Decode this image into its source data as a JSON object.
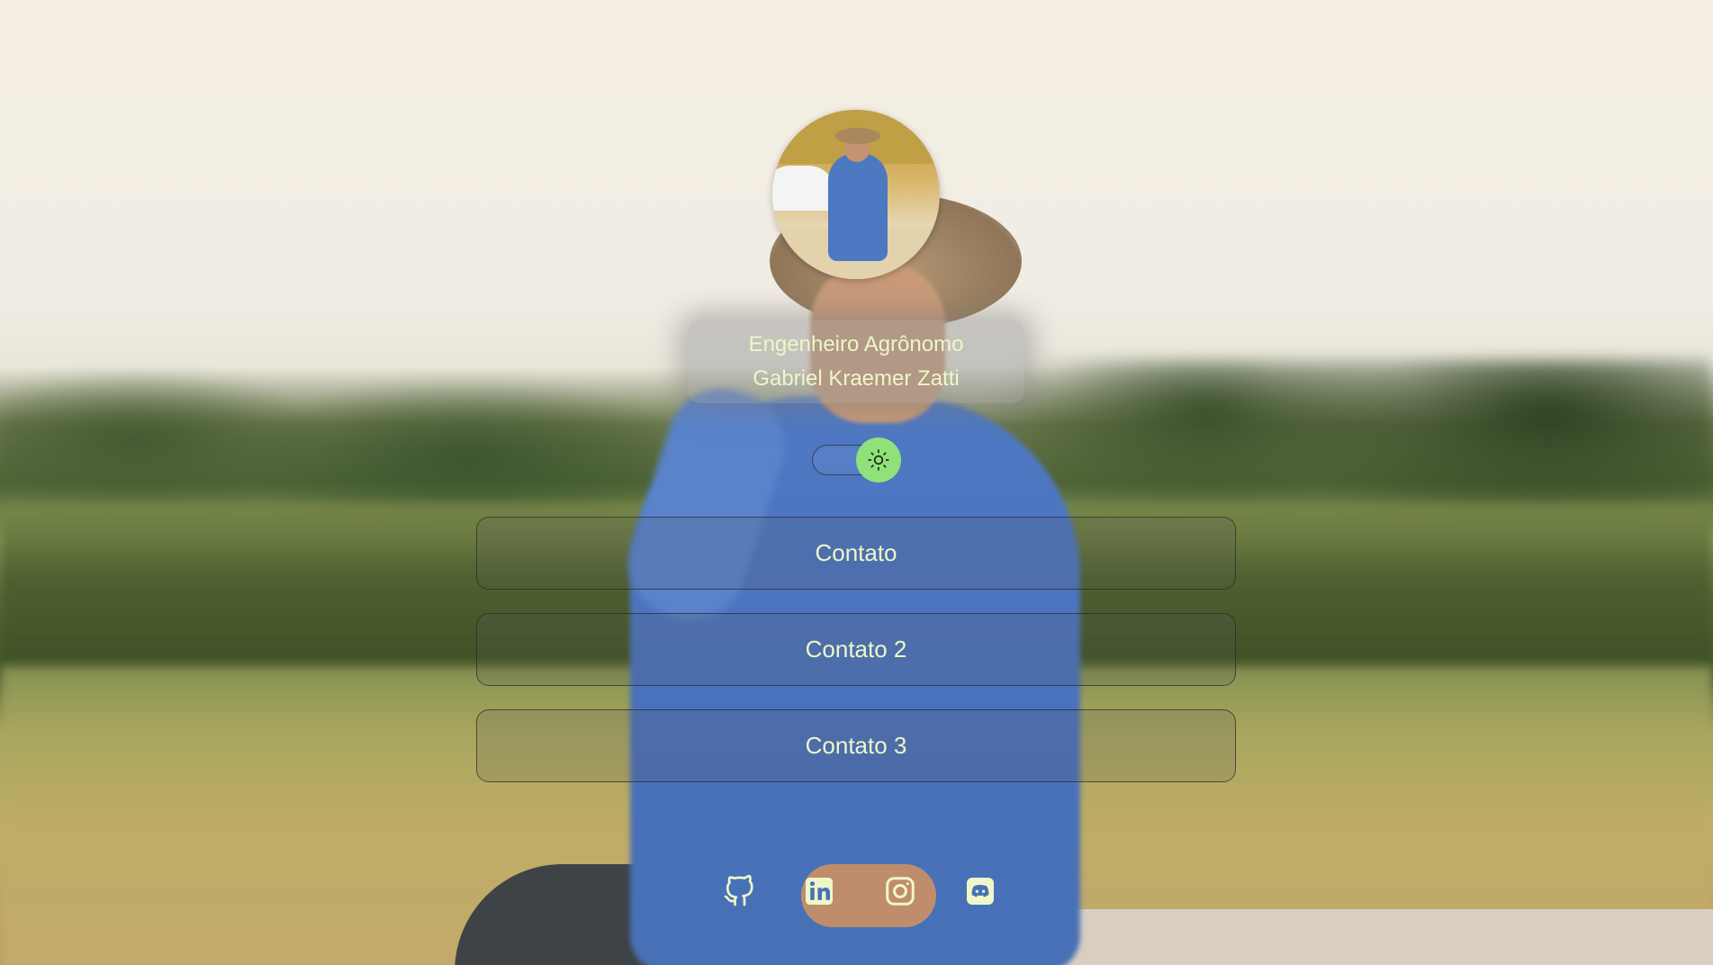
{
  "profile": {
    "line1": "Engenheiro Agrônomo",
    "line2": "Gabriel Kraemer Zatti",
    "avatar_alt": "profile-photo"
  },
  "theme_toggle": {
    "icon": "sun-icon",
    "knob_color": "#90e17a"
  },
  "links": [
    {
      "label": "Contato"
    },
    {
      "label": "Contato 2"
    },
    {
      "label": "Contato 3"
    }
  ],
  "socials": [
    {
      "icon": "github-icon"
    },
    {
      "icon": "linkedin-icon"
    },
    {
      "icon": "instagram-icon"
    },
    {
      "icon": "discord-icon"
    }
  ],
  "colors": {
    "text": "#eef7c8",
    "accent": "#90e17a"
  }
}
